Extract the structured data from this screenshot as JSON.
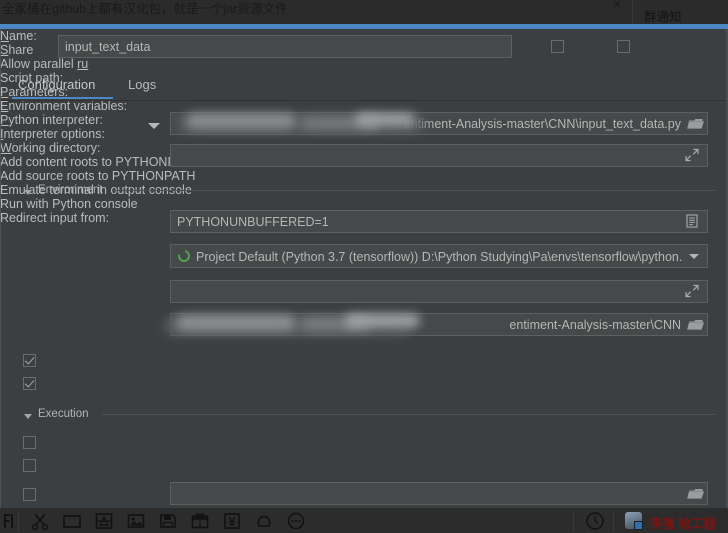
{
  "chat_popup": {
    "message": "全家桶在github上都有汉化包，就是一个jar资源文件",
    "close_icon": "close-icon",
    "title": "群通知"
  },
  "dialog": {
    "name_label": "Name:",
    "name_value": "input_text_data",
    "share": {
      "label": "Share",
      "checked": false
    },
    "allow_parallel": {
      "label": "Allow parallel ru",
      "checked": false
    },
    "tabs": [
      {
        "label": "Configuration",
        "active": true
      },
      {
        "label": "Logs",
        "active": false
      }
    ],
    "script_path": {
      "label": "Script path:",
      "value": "entiment-Analysis-master\\CNN\\input_text_data.py",
      "browse_icon": "folder-icon",
      "dropdown_icon": "chevron-down-icon"
    },
    "parameters": {
      "label": "Parameters:",
      "value": "",
      "expand_icon": "expand-icon"
    },
    "environment_section": {
      "label": "Environment",
      "collapse_icon": "triangle-down-icon"
    },
    "environment_variables": {
      "label": "Environment variables:",
      "value": "PYTHONUNBUFFERED=1",
      "edit_icon": "list-edit-icon"
    },
    "python_interpreter": {
      "label": "Python interpreter:",
      "value": "Project Default (Python 3.7 (tensorflow)) D:\\Python Studying\\Pa\\envs\\tensorflow\\python.",
      "status_icon": "python-env-icon",
      "dropdown_icon": "chevron-down-icon"
    },
    "interpreter_options": {
      "label": "Interpreter options:",
      "value": "",
      "expand_icon": "expand-icon"
    },
    "working_directory": {
      "label": "Working directory:",
      "value": "entiment-Analysis-master\\CNN",
      "browse_icon": "folder-icon"
    },
    "add_content_roots": {
      "label": "Add content roots to PYTHONPATH",
      "checked": true
    },
    "add_source_roots": {
      "label": "Add source roots to PYTHONPATH",
      "checked": true
    },
    "execution_section": {
      "label": "Execution",
      "collapse_icon": "triangle-down-icon"
    },
    "emulate_terminal": {
      "label": "Emulate terminal in output console",
      "checked": false
    },
    "run_with_console": {
      "label": "Run with Python console",
      "checked": false
    },
    "redirect_input": {
      "label": "Redirect input from:",
      "checked": false,
      "value": "",
      "browse_icon": "folder-icon"
    }
  },
  "taskbar": {
    "icons": [
      "screenshot-f-icon",
      "scissors-icon",
      "folder-icon",
      "screen-capture-icon",
      "image-icon",
      "save-disk-icon",
      "gift-icon",
      "yen-icon",
      "bell-icon",
      "more-icon"
    ],
    "clock_icon": "clock-icon",
    "avatar": "user-avatar",
    "user_name": "李强 哈工程"
  },
  "colors": {
    "accent": "#4a88c7",
    "dialog_bg": "#3c3f41",
    "field_bg": "#45494a",
    "text": "#bbbbbb",
    "user_name": "#7d1414",
    "python_green": "#4fa64f"
  }
}
